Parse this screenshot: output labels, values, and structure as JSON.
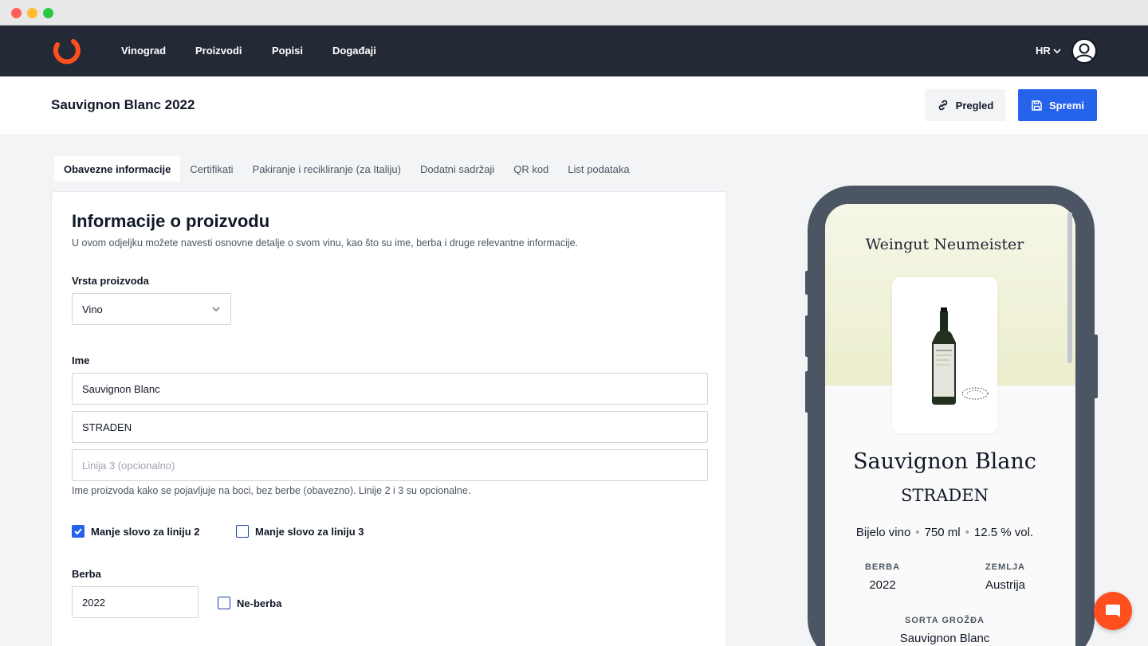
{
  "nav": {
    "items": [
      "Vinograd",
      "Proizvodi",
      "Popisi",
      "Događaji"
    ],
    "language": "HR"
  },
  "header": {
    "title": "Sauvignon Blanc 2022",
    "preview_label": "Pregled",
    "save_label": "Spremi"
  },
  "tabs": [
    "Obavezne informacije",
    "Certifikati",
    "Pakiranje i recikliranje (za Italiju)",
    "Dodatni sadržaji",
    "QR kod",
    "List podataka"
  ],
  "form": {
    "title": "Informacije o proizvodu",
    "description": "U ovom odjeljku možete navesti osnovne detalje o svom vinu, kao što su ime, berba i druge relevantne informacije.",
    "product_type_label": "Vrsta proizvoda",
    "product_type_value": "Vino",
    "name_label": "Ime",
    "name_line1": "Sauvignon Blanc",
    "name_line2": "STRADEN",
    "name_line3_placeholder": "Linija 3 (opcionalno)",
    "name_hint": "Ime proizvoda kako se pojavljuje na boci, bez berbe (obavezno). Linije 2 i 3 su opcionalne.",
    "lowercase_line2_label": "Manje slovo za liniju 2",
    "lowercase_line2_checked": true,
    "lowercase_line3_label": "Manje slovo za liniju 3",
    "lowercase_line3_checked": false,
    "vintage_label": "Berba",
    "vintage_value": "2022",
    "non_vintage_label": "Ne-berba",
    "non_vintage_checked": false
  },
  "preview": {
    "winery": "Weingut Neumeister",
    "wine_name": "Sauvignon Blanc",
    "wine_line2": "STRADEN",
    "specs": [
      "Bijelo vino",
      "750 ml",
      "12.5 % vol."
    ],
    "vintage_label": "BERBA",
    "vintage_value": "2022",
    "country_label": "ZEMLJA",
    "country_value": "Austrija",
    "grape_label": "SORTA GROŽĐA",
    "grape_value": "Sauvignon Blanc"
  },
  "colors": {
    "nav_bg": "#232a36",
    "primary": "#2563eb",
    "brand_orange": "#ff4f1f",
    "phone_frame": "#4b5563"
  }
}
